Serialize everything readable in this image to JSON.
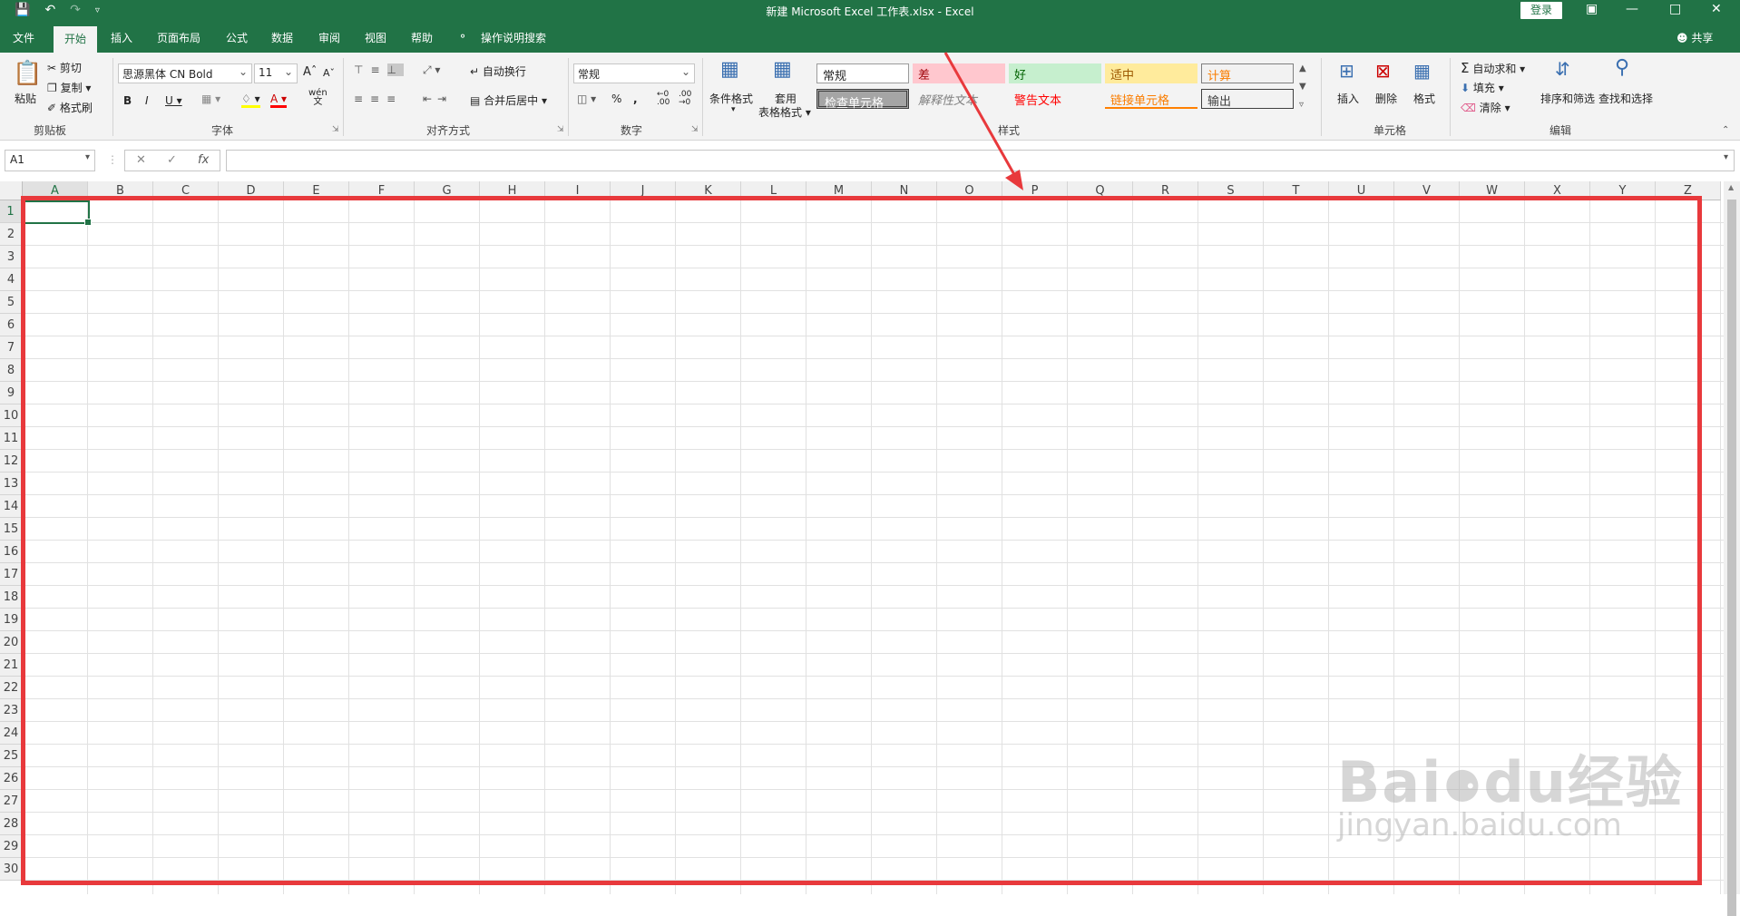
{
  "window": {
    "title": "新建 Microsoft Excel 工作表.xlsx  -  Excel",
    "signin_label": "登录",
    "share_label": "共享"
  },
  "tabs": [
    "文件",
    "开始",
    "插入",
    "页面布局",
    "公式",
    "数据",
    "审阅",
    "视图",
    "帮助"
  ],
  "active_tab": "开始",
  "tell_me": "操作说明搜索",
  "ribbon": {
    "clipboard": {
      "paste": "粘贴",
      "cut": "剪切",
      "copy": "复制",
      "format_painter": "格式刷",
      "label": "剪贴板"
    },
    "font": {
      "name": "思源黑体 CN Bold",
      "size": "11",
      "label": "字体",
      "wen": "wén",
      "wen_char": "文"
    },
    "alignment": {
      "wrap": "自动换行",
      "merge": "合并后居中",
      "label": "对齐方式"
    },
    "number": {
      "format": "常规",
      "percent": "%",
      "comma": ",",
      "label": "数字"
    },
    "styles": {
      "conditional": "条件格式",
      "table_1": "套用",
      "table_2": "表格格式",
      "label": "样式",
      "cells": [
        "常规",
        "差",
        "好",
        "适中",
        "计算",
        "检查单元格",
        "解释性文本",
        "警告文本",
        "链接单元格",
        "输出"
      ]
    },
    "cells": {
      "insert": "插入",
      "delete": "删除",
      "format": "格式",
      "label": "单元格"
    },
    "editing": {
      "autosum": "自动求和",
      "fill": "填充",
      "clear": "清除",
      "sort": "排序和筛选",
      "find": "查找和选择",
      "label": "编辑"
    }
  },
  "formula_bar": {
    "name_box": "A1",
    "fx": "fx",
    "cancel": "✕",
    "enter": "✓"
  },
  "columns": [
    "A",
    "B",
    "C",
    "D",
    "E",
    "F",
    "G",
    "H",
    "I",
    "J",
    "K",
    "L",
    "M",
    "N",
    "O",
    "P",
    "Q",
    "R",
    "S",
    "T",
    "U",
    "V",
    "W",
    "X",
    "Y",
    "Z"
  ],
  "rows": [
    "1",
    "2",
    "3",
    "4",
    "5",
    "6",
    "7",
    "8",
    "9",
    "10",
    "11",
    "12",
    "13",
    "14",
    "15",
    "16",
    "17",
    "18",
    "19",
    "20",
    "21",
    "22",
    "23",
    "24",
    "25",
    "26",
    "27",
    "28",
    "29",
    "30"
  ],
  "watermark": {
    "brand": "Bai",
    "brand2": "du",
    "brand3": "经验",
    "url": "jingyan.baidu.com"
  },
  "colors": {
    "excel_green": "#217346",
    "annotation_red": "#e8393c"
  }
}
